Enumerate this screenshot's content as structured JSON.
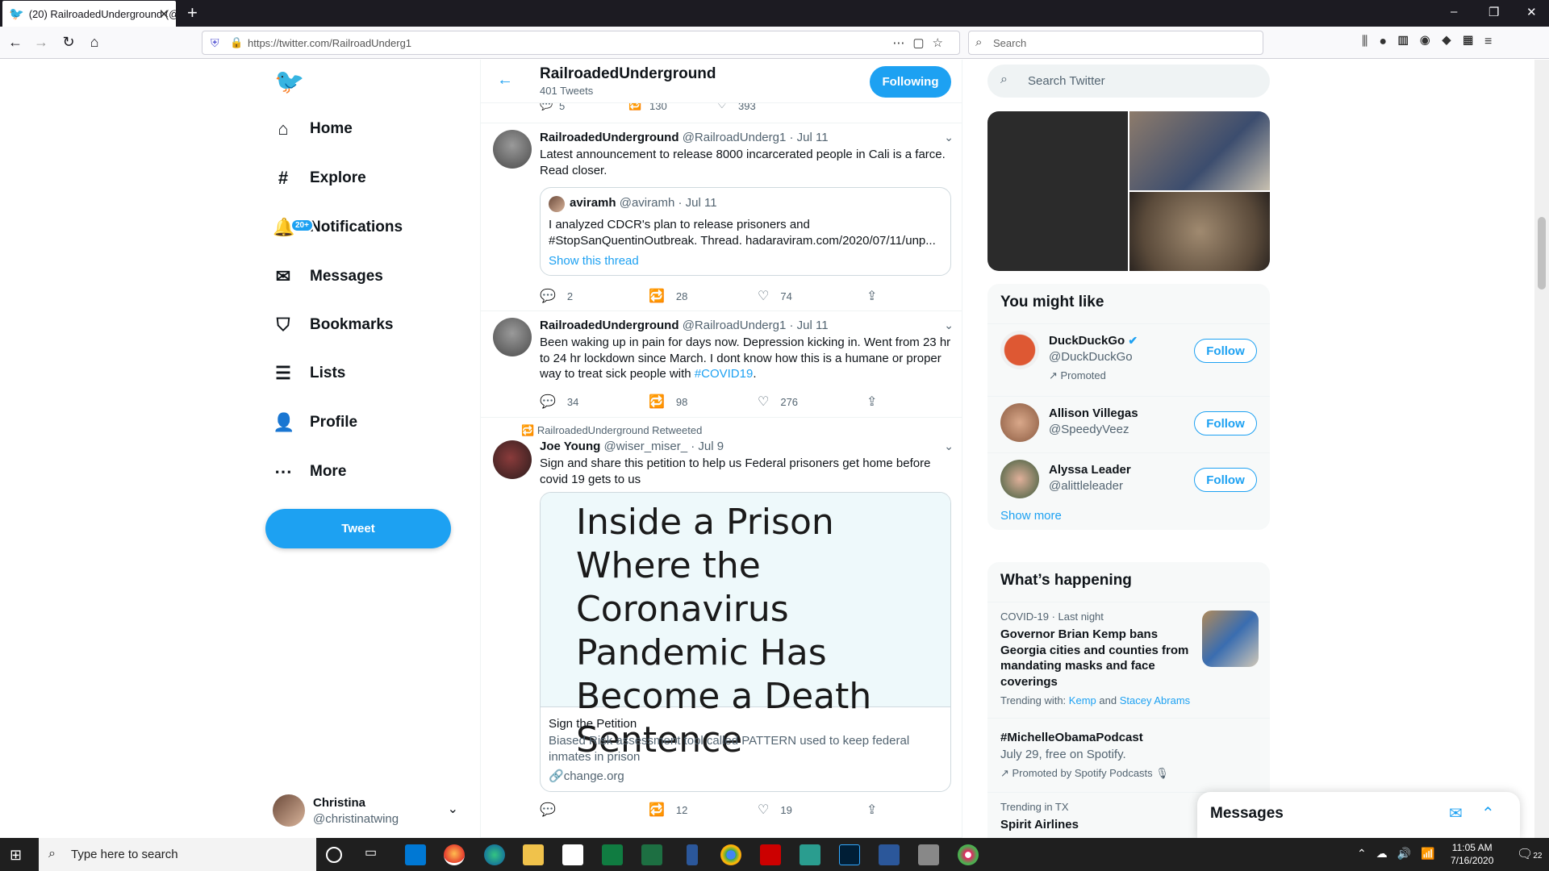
{
  "browser": {
    "tab_title": "(20) RailroadedUnderground (@",
    "url": "https://twitter.com/RailroadUnderg1",
    "search_placeholder": "Search"
  },
  "nav": {
    "items": [
      {
        "label": "Home",
        "icon": "home-icon"
      },
      {
        "label": "Explore",
        "icon": "hashtag-icon"
      },
      {
        "label": "Notifications",
        "icon": "bell-icon",
        "badge": "20+"
      },
      {
        "label": "Messages",
        "icon": "envelope-icon"
      },
      {
        "label": "Bookmarks",
        "icon": "bookmark-icon"
      },
      {
        "label": "Lists",
        "icon": "list-icon"
      },
      {
        "label": "Profile",
        "icon": "person-icon"
      },
      {
        "label": "More",
        "icon": "more-circle-icon"
      }
    ],
    "tweet_button": "Tweet",
    "account": {
      "name": "Christina",
      "handle": "@christinatwing"
    }
  },
  "header": {
    "title": "RailroadedUnderground",
    "subtitle": "401 Tweets",
    "following_button": "Following"
  },
  "partial_actions": {
    "replies": "5",
    "retweets": "130",
    "likes": "393"
  },
  "tweets": [
    {
      "name": "RailroadedUnderground",
      "handle": "@RailroadUnderg1",
      "date": "· Jul 11",
      "text": "Latest announcement to release 8000 incarcerated people in Cali is a farce. Read closer.",
      "quote": {
        "name": "aviramh",
        "handle": "@aviramh",
        "date": "· Jul 11",
        "text": "I analyzed CDCR's plan to release prisoners and #StopSanQuentinOutbreak. Thread. hadaraviram.com/2020/07/11/unp...",
        "link": "Show this thread"
      },
      "replies": "2",
      "retweets": "28",
      "likes": "74"
    },
    {
      "name": "RailroadedUnderground",
      "handle": "@RailroadUnderg1",
      "date": "· Jul 11",
      "text_before": "Been waking up in pain for days now. Depression kicking in. Went from 23 hr to 24 hr lockdown since March. I dont know how this is a humane or proper way to treat sick people with ",
      "hashtag": "#COVID19",
      "text_after": ".",
      "replies": "34",
      "retweets": "98",
      "likes": "276"
    },
    {
      "retweet_label": "RailroadedUnderground Retweeted",
      "name": "Joe Young",
      "handle": "@wiser_miser_",
      "date": "· Jul 9",
      "text": "Sign and share this petition to help us Federal prisoners get home before covid 19 gets to us",
      "card": {
        "headline": "Inside a Prison Where the Coronavirus Pandemic Has Become a Death Sentence",
        "title": "Sign the Petition",
        "description": "Biased Risk assessment tool called PATTERN used to keep federal inmates in prison",
        "domain": "change.org"
      },
      "replies": "",
      "retweets": "12",
      "likes": "19"
    }
  ],
  "sidebar": {
    "search_placeholder": "Search Twitter",
    "you_might_like": {
      "title": "You might like",
      "suggestions": [
        {
          "name": "DuckDuckGo",
          "handle": "@DuckDuckGo",
          "promoted": "Promoted",
          "follow": "Follow"
        },
        {
          "name": "Allison Villegas",
          "handle": "@SpeedyVeez",
          "follow": "Follow"
        },
        {
          "name": "Alyssa Leader",
          "handle": "@alittleleader",
          "follow": "Follow"
        }
      ],
      "show_more": "Show more"
    },
    "whats_happening": {
      "title": "What’s happening",
      "trends": [
        {
          "meta": "COVID-19 · Last night",
          "title": "Governor Brian Kemp bans Georgia cities and counties from mandating masks and face coverings",
          "trending_with_label": "Trending with:",
          "link1": "Kemp",
          "and": "and",
          "link2": "Stacey Abrams"
        },
        {
          "title": "#MichelleObamaPodcast",
          "sub": "July 29, free on Spotify.",
          "promoted": "Promoted by Spotify Podcasts"
        },
        {
          "meta": "Trending in TX",
          "title": "Spirit Airlines"
        }
      ]
    }
  },
  "messages_drawer": {
    "title": "Messages"
  },
  "taskbar": {
    "search_placeholder": "Type here to search",
    "time": "11:05 AM",
    "date": "7/16/2020",
    "notifications": "22"
  }
}
